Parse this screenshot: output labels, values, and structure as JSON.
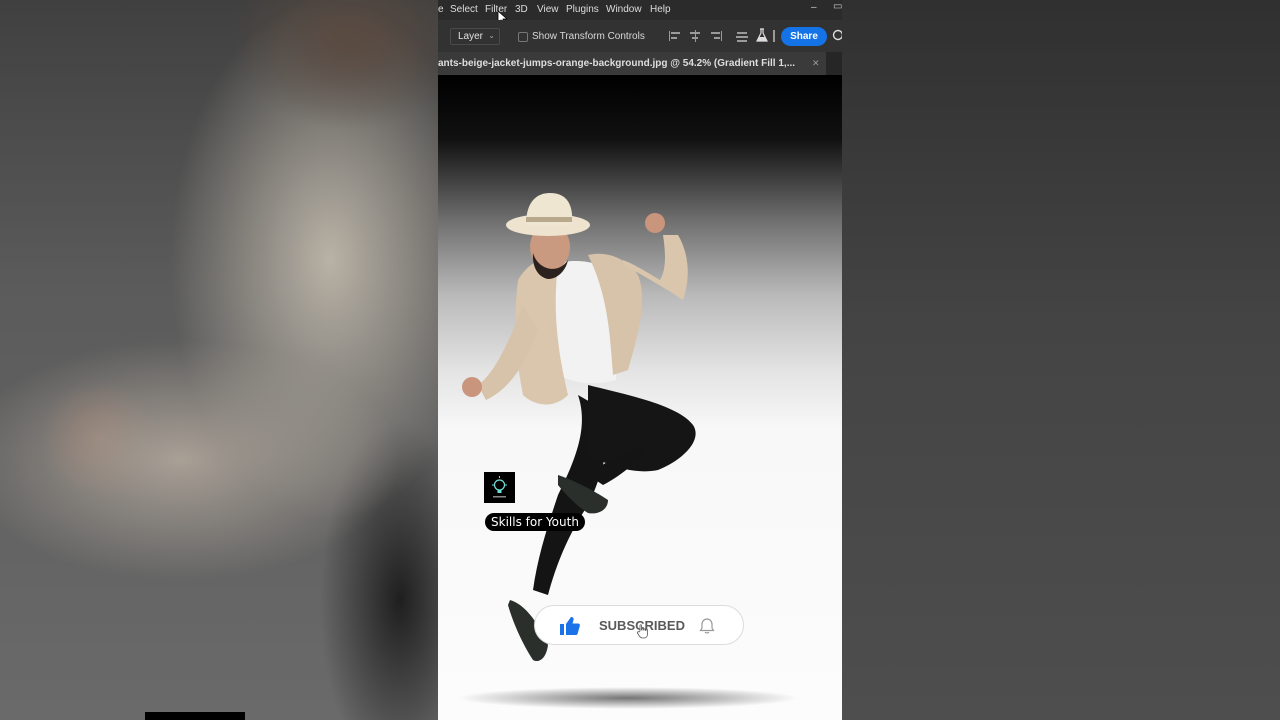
{
  "menu": {
    "items": [
      "e",
      "Select",
      "Filter",
      "3D",
      "View",
      "Plugins",
      "Window",
      "Help"
    ]
  },
  "options_bar": {
    "layer_select": "Layer",
    "show_transform_controls": "Show Transform Controls",
    "share_label": "Share"
  },
  "document": {
    "tab_title": "ants-beige-jacket-jumps-orange-background.jpg @ 54.2% (Gradient Fill 1,..."
  },
  "overlay": {
    "channel_name": "Skills for Youth",
    "subscribe_label": "SUBSCRIBED"
  },
  "colors": {
    "accent_blue": "#1473e6",
    "thumb_blue": "#1a73e8"
  }
}
